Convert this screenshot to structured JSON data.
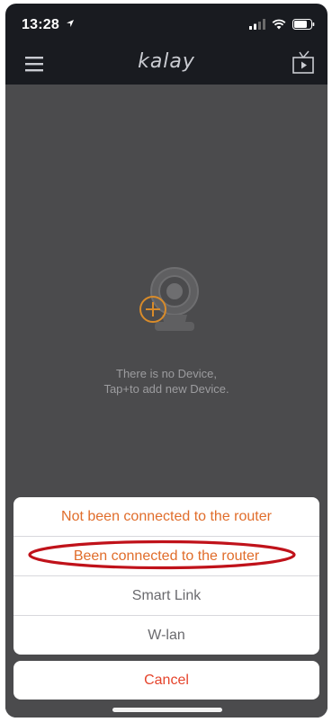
{
  "status_bar": {
    "time": "13:28",
    "icons": [
      "location-arrow-icon",
      "cellular-signal-icon",
      "wifi-icon",
      "battery-icon"
    ]
  },
  "nav_bar": {
    "logo": "kalay",
    "menu_icon": "hamburger-menu-icon",
    "tv_icon": "tv-play-icon"
  },
  "empty_state": {
    "illustration": "add-camera-icon",
    "line1": "There is no Device,",
    "line2": "Tap+to add new Device."
  },
  "action_sheet": {
    "items": [
      {
        "label": "Not been connected to the router",
        "color": "#e06d2b"
      },
      {
        "label": "Been connected to the router",
        "color": "#e06d2b"
      },
      {
        "label": "Smart Link",
        "color": "#6a6a6e"
      },
      {
        "label": "W-lan",
        "color": "#6a6a6e"
      }
    ],
    "cancel_label": "Cancel",
    "cancel_color": "#e5442c"
  },
  "colors": {
    "background_dark": "#191b20",
    "content_gray": "#4b4b4d",
    "accent_orange": "#e06d2b",
    "annotation_red": "#c0121a"
  }
}
